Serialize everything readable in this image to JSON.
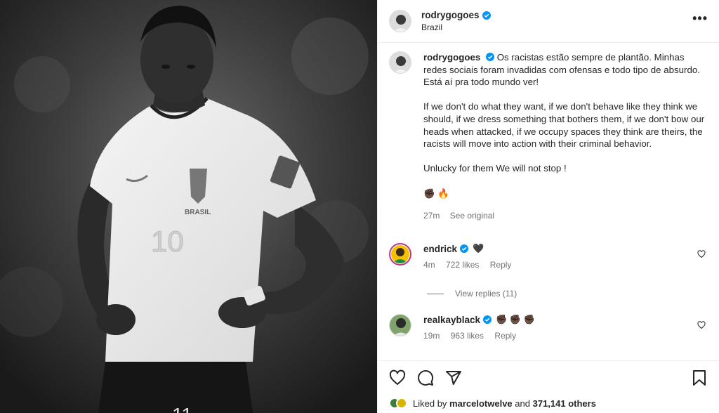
{
  "header": {
    "username": "rodrygogoes",
    "location": "Brazil",
    "more_label": "•••"
  },
  "caption": {
    "username": "rodrygogoes",
    "line1_text": "Os racistas estão sempre de plantão. Minhas redes sociais foram invadidas com ofensas e todo tipo de absurdo. Está aí pra todo mundo ver!",
    "para2": "If we don't do what they want, if we don't behave like they think we should, if we dress something that bothers them, if we don't bow our heads when attacked, if we occupy spaces they think are theirs, the racists will move into action with their criminal behavior.",
    "para3": "Unlucky for them We will not stop !",
    "emojis": "✊🏿 🔥",
    "time": "27m",
    "see_original": "See original"
  },
  "comments": [
    {
      "username": "endrick",
      "emoji": "🖤",
      "time": "4m",
      "likes": "722 likes",
      "reply": "Reply",
      "view_replies": "View replies (11)"
    },
    {
      "username": "realkayblack",
      "emoji": "✊🏿 ✊🏿 ✊🏿",
      "time": "19m",
      "likes": "963 likes",
      "reply": "Reply"
    }
  ],
  "likes_line": {
    "prefix": "Liked by",
    "user": "marcelotwelve",
    "middle": "and",
    "count": "371,141 others"
  },
  "icons": {
    "like": "heart-icon",
    "comment": "comment-icon",
    "share": "share-icon",
    "save": "bookmark-icon",
    "verified": "verified-badge-icon"
  },
  "colors": {
    "verified": "#0095f6",
    "secondary_text": "#737373",
    "divider": "#efefef"
  }
}
